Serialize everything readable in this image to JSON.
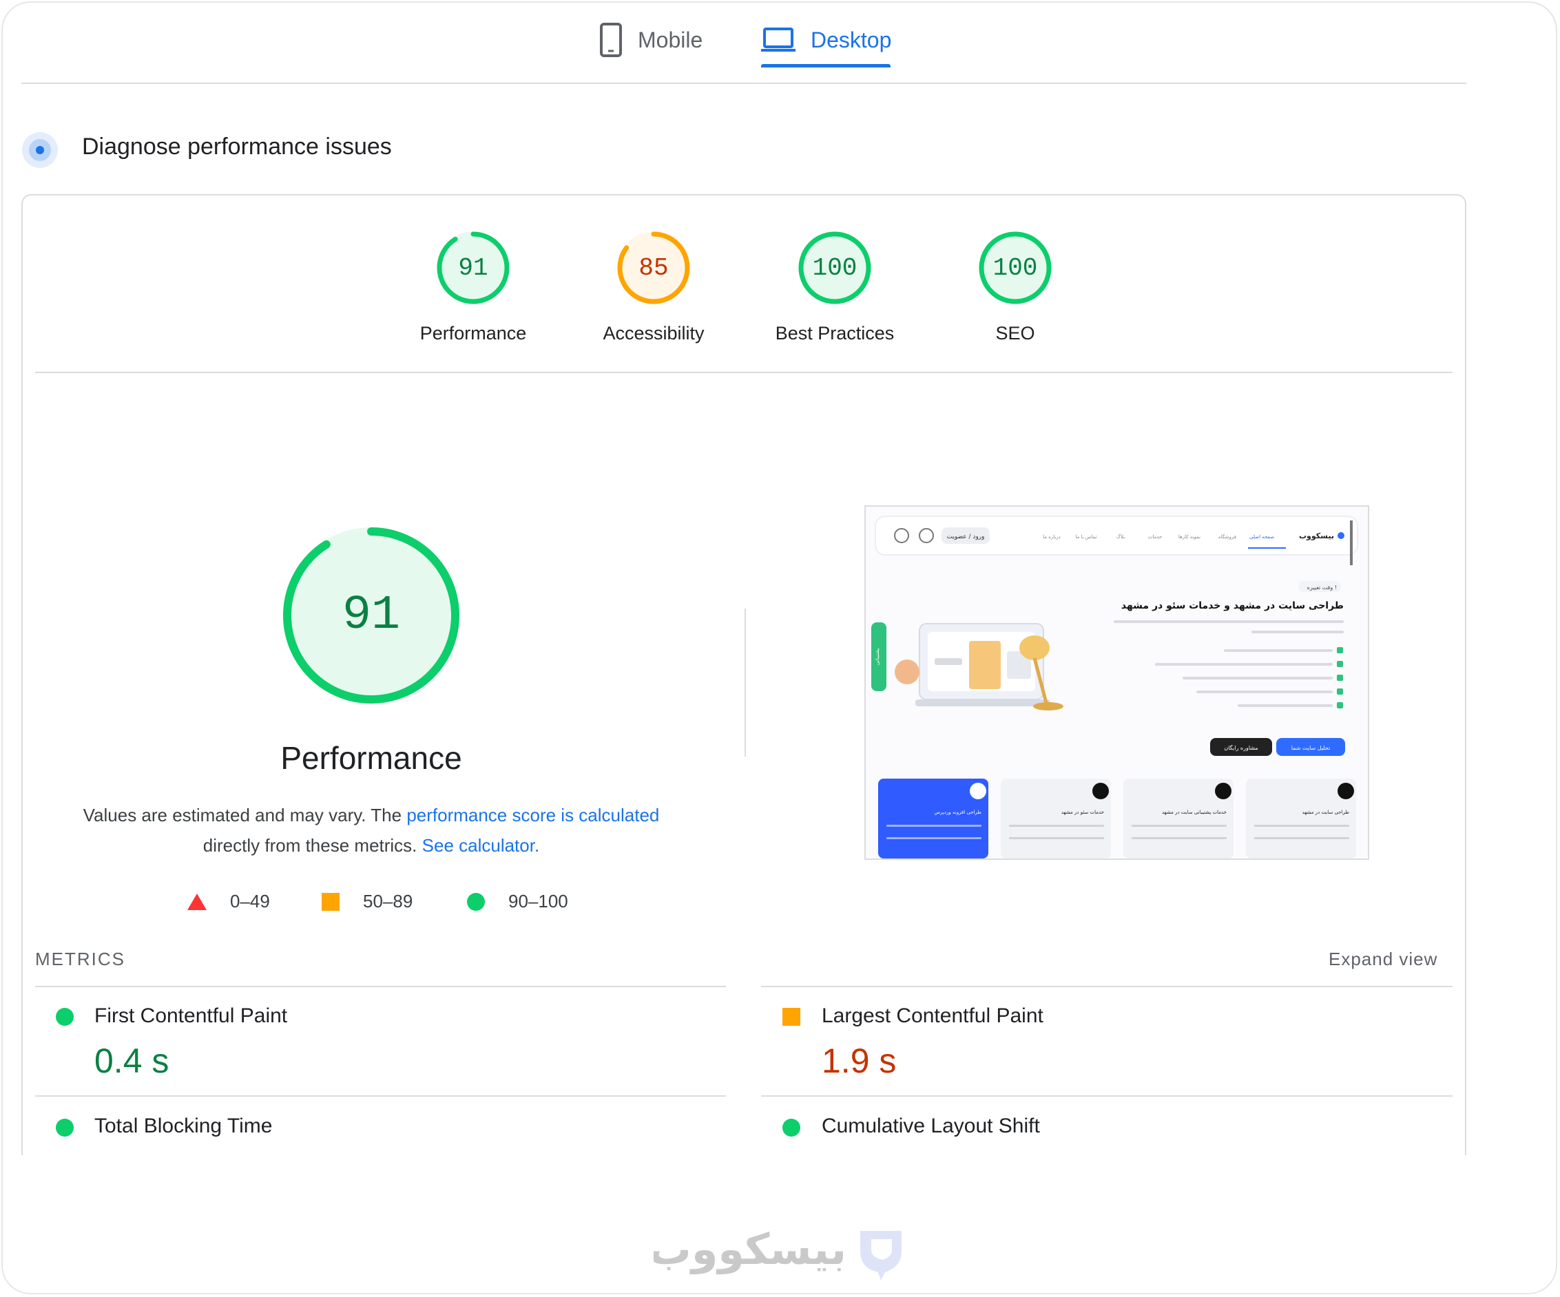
{
  "tabs": [
    {
      "label": "Mobile",
      "icon": "phone-icon",
      "active": false
    },
    {
      "label": "Desktop",
      "icon": "laptop-icon",
      "active": true
    }
  ],
  "section_title": "Diagnose performance issues",
  "categories": [
    {
      "label": "Performance",
      "score": "91",
      "status": "pass"
    },
    {
      "label": "Accessibility",
      "score": "85",
      "status": "average"
    },
    {
      "label": "Best Practices",
      "score": "100",
      "status": "pass"
    },
    {
      "label": "SEO",
      "score": "100",
      "status": "pass"
    }
  ],
  "main_score": {
    "value": "91",
    "fraction": 0.91,
    "title": "Performance"
  },
  "note": {
    "prefix": "Values are estimated and may vary. The ",
    "link1": "performance score is calculated",
    "middle": "directly from these metrics. ",
    "link2": "See calculator."
  },
  "legend": [
    {
      "range": "0–49",
      "shape": "triangle",
      "color": "#ff3333"
    },
    {
      "range": "50–89",
      "shape": "square",
      "color": "#ffa400"
    },
    {
      "range": "90–100",
      "shape": "circle",
      "color": "#0cce6b"
    }
  ],
  "metrics_header": "METRICS",
  "expand_view": "Expand view",
  "metrics": [
    {
      "name": "First Contentful Paint",
      "value": "0.4 s",
      "status": "pass"
    },
    {
      "name": "Largest Contentful Paint",
      "value": "1.9 s",
      "status": "average"
    },
    {
      "name": "Total Blocking Time",
      "value": "",
      "status": "pass"
    },
    {
      "name": "Cumulative Layout Shift",
      "value": "",
      "status": "pass"
    }
  ],
  "colors": {
    "pass": "#0cce6b",
    "pass_text": "#0b8043",
    "pass_bg": "#e6f9ee",
    "average": "#ffa400",
    "average_text": "#c33300",
    "average_bg": "#fff6e8",
    "fail": "#ff3333",
    "accent": "#1a73e8"
  },
  "screenshot": {
    "brand": "بیسکووب",
    "nav_items": [
      "صفحه اصلی",
      "فروشگاه",
      "نمونه کارها",
      "خدمات",
      "بلاگ",
      "تماس با ما",
      "درباره ما"
    ],
    "login_button": "ورود / عضویت",
    "badge": "وقت تغییره !",
    "headline": "طراحی سایت در مشهد و خدمات سئو در مشهد",
    "cta_primary": "تحلیل سایت شما",
    "cta_secondary": "مشاوره رایگان",
    "cards": [
      "طراحی سایت در مشهد",
      "خدمات پشتیبانی سایت در مشهد",
      "خدمات سئو در مشهد",
      "طراحی افزونه وردپرس"
    ],
    "side_tab": "پشتیبانی"
  },
  "watermark": "بیسکووب"
}
